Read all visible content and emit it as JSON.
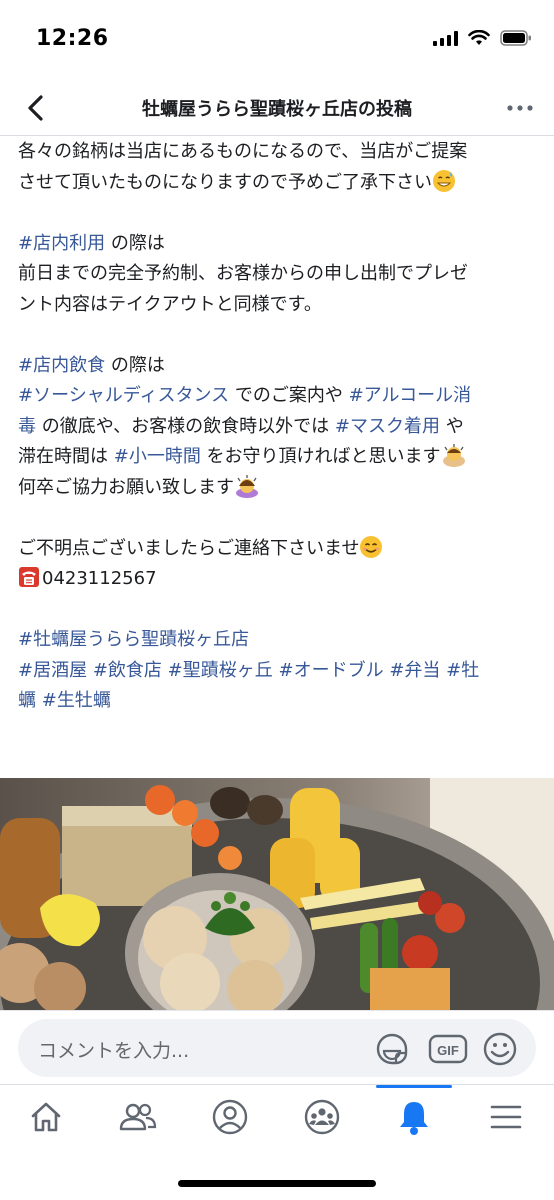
{
  "status_bar": {
    "time": "12:26"
  },
  "header": {
    "title": "牡蠣屋うらら聖蹟桜ヶ丘店の投稿"
  },
  "post": {
    "p1": [
      "各々の銘柄は当店にあるものになるので、当店がご提案",
      "させて頂いたものになりますので予めご了承下さい"
    ],
    "p2": {
      "tag": "#店内利用",
      "after_tag": " の際は",
      "l2": "前日までの完全予約制、お客様からの申し出制でプレゼ",
      "l3": "ント内容はテイクアウトと同様です。"
    },
    "p3": {
      "tag1": "#店内飲食",
      "t1": " の際は",
      "tag2": "#ソーシャルディスタンス",
      "t2": " でのご案内や ",
      "tag3a": "#アルコール消",
      "tag3b": "毒",
      "t3": " の徹底や、お客様の飲食時以外では ",
      "tag4": "#マスク着用",
      "t4": " や",
      "t5": "滞在時間は ",
      "tag5": "#小一時間",
      "t6": " をお守り頂ければと思います",
      "l5": "何卒ご協力お願い致します"
    },
    "p4": {
      "l1": "ご不明点ございましたらご連絡下さいませ",
      "phone": "0423112567"
    },
    "p5": {
      "tag1": "#牡蠣屋うらら聖蹟桜ヶ丘店",
      "tags2": [
        "#居酒屋",
        "#飲食店",
        "#聖蹟桜ヶ丘",
        "#オードブル",
        "#弁当",
        "#牡"
      ],
      "tag_cont": "蠣",
      "tag_last": "#生牡蠣"
    }
  },
  "comment_bar": {
    "placeholder": "コメントを入力...",
    "gif_label": "GIF"
  },
  "tabs": [
    {
      "name": "home",
      "icon": "home-icon"
    },
    {
      "name": "friends",
      "icon": "friends-icon"
    },
    {
      "name": "profile",
      "icon": "profile-icon"
    },
    {
      "name": "groups",
      "icon": "groups-icon"
    },
    {
      "name": "notifications",
      "icon": "bell-icon",
      "active": true
    },
    {
      "name": "menu",
      "icon": "menu-icon"
    }
  ],
  "colors": {
    "accent": "#1877f2",
    "hashtag": "#385898",
    "text": "#1c1e21",
    "muted": "#65676b"
  },
  "photo": {
    "icon": "food-platter-photo"
  }
}
